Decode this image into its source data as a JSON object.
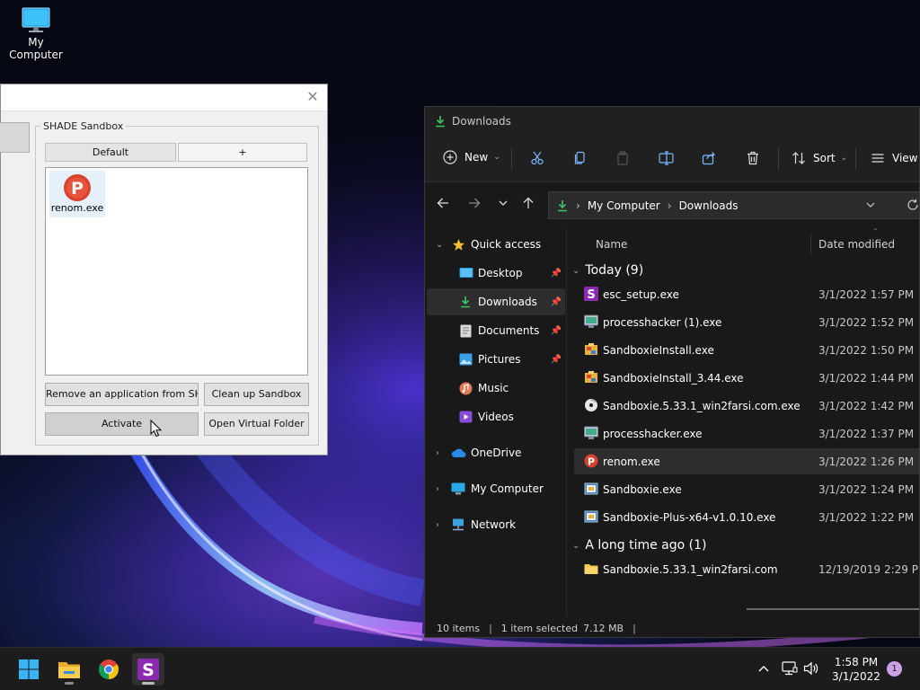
{
  "desktop": {
    "icons": [
      {
        "label": "My Computer",
        "icon": "computer-icon"
      }
    ]
  },
  "shade": {
    "group_title": "SHADE Sandbox",
    "tabs": [
      {
        "label": "Default"
      },
      {
        "label": "+"
      }
    ],
    "apps": [
      {
        "label": "renom.exe",
        "icon": "psiphon-icon"
      }
    ],
    "buttons": {
      "remove": "Remove an application from SHADE",
      "cleanup": "Clean up Sandbox",
      "activate": "Activate",
      "open_folder": "Open Virtual Folder"
    },
    "close_icon": "close-icon"
  },
  "explorer": {
    "title": "Downloads",
    "toolbar": {
      "new_label": "New",
      "sort_label": "Sort",
      "view_label": "View"
    },
    "address": {
      "crumbs": [
        "My Computer",
        "Downloads"
      ]
    },
    "nav": {
      "quick_access": "Quick access",
      "desktop": "Desktop",
      "downloads": "Downloads",
      "documents": "Documents",
      "pictures": "Pictures",
      "music": "Music",
      "videos": "Videos",
      "onedrive": "OneDrive",
      "my_computer": "My Computer",
      "network": "Network"
    },
    "columns": {
      "name": "Name",
      "date": "Date modified"
    },
    "groups": {
      "today": "Today (9)",
      "long_ago": "A long time ago (1)"
    },
    "files": [
      {
        "name": "esc_setup.exe",
        "date": "3/1/2022 1:57 PM",
        "icon": "shade-app-icon"
      },
      {
        "name": "processhacker (1).exe",
        "date": "3/1/2022 1:52 PM",
        "icon": "app-icon"
      },
      {
        "name": "SandboxieInstall.exe",
        "date": "3/1/2022 1:50 PM",
        "icon": "installer-icon"
      },
      {
        "name": "SandboxieInstall_3.44.exe",
        "date": "3/1/2022 1:44 PM",
        "icon": "installer-icon"
      },
      {
        "name": "Sandboxie.5.33.1_win2farsi.com.exe",
        "date": "3/1/2022 1:42 PM",
        "icon": "disc-icon"
      },
      {
        "name": "processhacker.exe",
        "date": "3/1/2022 1:37 PM",
        "icon": "app-icon"
      },
      {
        "name": "renom.exe",
        "date": "3/1/2022 1:26 PM",
        "icon": "psiphon-icon"
      },
      {
        "name": "Sandboxie.exe",
        "date": "3/1/2022 1:24 PM",
        "icon": "sandboxie-icon"
      },
      {
        "name": "Sandboxie-Plus-x64-v1.0.10.exe",
        "date": "3/1/2022 1:22 PM",
        "icon": "sandboxie-icon"
      },
      {
        "name": "Sandboxie.5.33.1_win2farsi.com",
        "date": "12/19/2019 2:29 PM",
        "icon": "folder-icon"
      }
    ],
    "status": {
      "count": "10 items",
      "selected": "1 item selected",
      "size": "7.12 MB"
    }
  },
  "taskbar": {
    "time": "1:58 PM",
    "date": "3/1/2022",
    "notifications": "1"
  }
}
